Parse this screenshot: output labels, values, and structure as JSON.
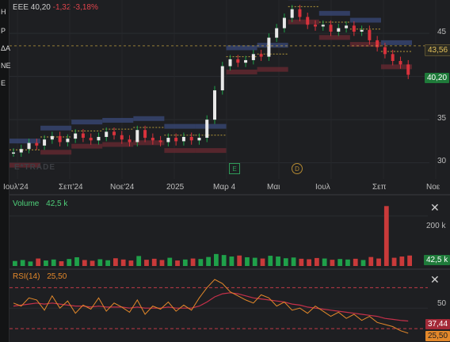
{
  "sidebar": {
    "items": [
      "Η",
      "Ρ",
      "ΔΑ",
      "ΝΕ",
      "Ε"
    ]
  },
  "legend": {
    "symbol": "EEE",
    "price": "40,20",
    "change": "-1,32",
    "change_pct": "-3,18%"
  },
  "watermark": "E*TRADE",
  "price_axis": {
    "ticks": [
      "45",
      "40",
      "35",
      "30"
    ],
    "tag_prev": "43,56",
    "tag_last": "40,20"
  },
  "time_axis": {
    "labels": [
      "Ιουλ'24",
      "Σεπ'24",
      "Νοε'24",
      "2025",
      "Μαρ 4",
      "Μαι",
      "Ιουλ",
      "Σεπ",
      "Νοε"
    ]
  },
  "events": {
    "earnings": "E",
    "dividend": "D"
  },
  "volume_pane": {
    "title": "Volume",
    "value": "42,5 k",
    "tick": "200 k",
    "tag": "42,5 k"
  },
  "rsi_pane": {
    "title": "RSI(14)",
    "value": "25,50",
    "tick": "50",
    "tag_ma": "37,44",
    "tag_rsi": "25,50"
  },
  "colors": {
    "up": "#1fa14a",
    "down": "#d8323c",
    "rsi": "#e3882a",
    "rsi_ma": "#c6304a",
    "volume_up": "#1fa14a",
    "volume_down": "#c93a3a",
    "band_blue": "#3a4a7a",
    "band_red": "#6a2a32"
  },
  "chart_data": [
    {
      "type": "line",
      "series": [
        {
          "values": [
            31.2,
            31.6,
            32.3,
            32.0,
            32.7,
            33.1,
            32.4,
            32.8,
            33.4,
            32.9,
            32.6,
            33.0,
            33.6,
            33.2,
            32.7,
            32.4,
            33.8,
            32.9,
            32.6,
            32.4,
            32.9,
            32.5,
            33.0,
            32.6,
            32.9,
            35.0,
            38.4,
            41.2,
            42.0,
            41.6,
            41.9,
            42.6,
            42.3,
            44.5,
            45.6,
            46.8,
            47.8,
            46.9,
            46.0,
            45.8,
            46.0,
            45.2,
            45.6,
            45.9,
            45.2,
            45.4,
            44.2,
            43.4,
            42.6,
            41.8,
            41.4,
            40.2
          ]
        }
      ],
      "x": [
        "Ιουλ'24",
        "Σεπ'24",
        "Νοε'24",
        "2025",
        "Μαρ 4",
        "Μαι",
        "Ιουλ",
        "Σεπ",
        "Νοε"
      ],
      "ylim": [
        28.5,
        48.5
      ]
    },
    {
      "type": "bar",
      "series": [
        {
          "values": [
            20,
            24,
            18,
            30,
            22,
            26,
            19,
            28,
            35,
            24,
            21,
            27,
            23,
            31,
            26,
            22,
            40,
            25,
            29,
            24,
            33,
            22,
            26,
            30,
            28,
            36,
            48,
            44,
            38,
            42,
            35,
            33,
            30,
            41,
            38,
            31,
            34,
            29,
            27,
            32,
            30,
            25,
            28,
            26,
            29,
            24,
            36,
            30,
            240,
            33,
            38,
            42
          ]
        }
      ],
      "ylim": [
        0,
        260
      ]
    },
    {
      "type": "line",
      "series": [
        {
          "values": [
            55,
            52,
            60,
            58,
            48,
            62,
            50,
            57,
            45,
            53,
            49,
            60,
            47,
            55,
            51,
            46,
            58,
            44,
            52,
            49,
            56,
            47,
            53,
            48,
            60,
            70,
            78,
            74,
            66,
            62,
            58,
            55,
            63,
            60,
            52,
            56,
            48,
            50,
            45,
            52,
            47,
            42,
            46,
            40,
            44,
            38,
            42,
            36,
            34,
            32,
            28,
            25.5
          ]
        },
        {
          "values": [
            52,
            53,
            54,
            55,
            54,
            55,
            54,
            53,
            52,
            52,
            51,
            52,
            51,
            51,
            51,
            50,
            51,
            50,
            50,
            50,
            51,
            50,
            50,
            50,
            52,
            56,
            61,
            64,
            65,
            64,
            62,
            60,
            59,
            58,
            57,
            56,
            54,
            53,
            51,
            50,
            49,
            48,
            47,
            46,
            45,
            44,
            43,
            42,
            40,
            39,
            38,
            37.4
          ]
        }
      ],
      "ylim": [
        20,
        85
      ]
    }
  ]
}
